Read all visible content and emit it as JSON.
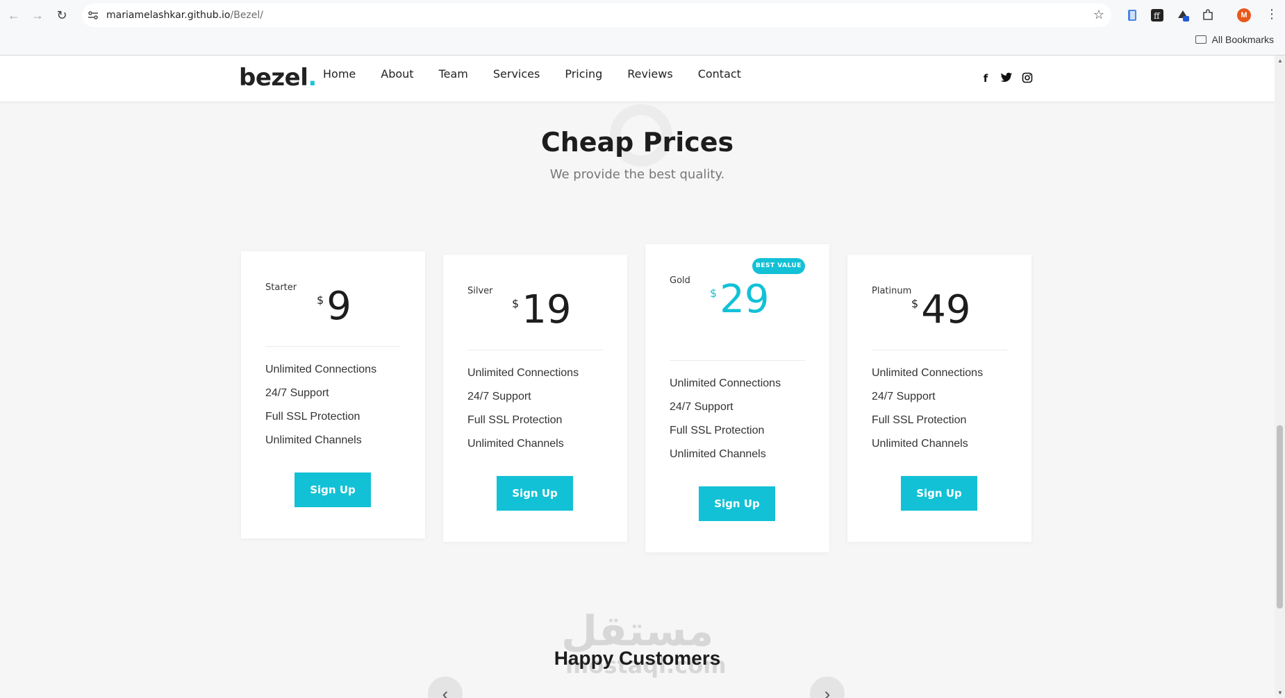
{
  "browser": {
    "url_host": "mariamelashkar.github.io",
    "url_path": "/Bezel/",
    "bookmarks_label": "All Bookmarks",
    "profile_initial": "M"
  },
  "site": {
    "logo_text": "bezel",
    "logo_dot": ".",
    "menu": [
      "Home",
      "About",
      "Team",
      "Services",
      "Pricing",
      "Reviews",
      "Contact"
    ],
    "social_icons": [
      "facebook-icon",
      "twitter-icon",
      "instagram-icon"
    ]
  },
  "pricing": {
    "title": "Cheap Prices",
    "subtitle": "We provide the best quality.",
    "currency": "$",
    "plans": [
      {
        "name": "Starter",
        "price": "9",
        "features": [
          "Unlimited Connections",
          "24/7 Support",
          "Full SSL Protection",
          "Unlimited Channels"
        ],
        "cta": "Sign Up"
      },
      {
        "name": "Silver",
        "price": "19",
        "features": [
          "Unlimited Connections",
          "24/7 Support",
          "Full SSL Protection",
          "Unlimited Channels"
        ],
        "cta": "Sign Up"
      },
      {
        "name": "Gold",
        "price": "29",
        "badge": "BEST VALUE",
        "features": [
          "Unlimited Connections",
          "24/7 Support",
          "Full SSL Protection",
          "Unlimited Channels"
        ],
        "cta": "Sign Up"
      },
      {
        "name": "Platinum",
        "price": "49",
        "features": [
          "Unlimited Connections",
          "24/7 Support",
          "Full SSL Protection",
          "Unlimited Channels"
        ],
        "cta": "Sign Up"
      }
    ]
  },
  "testimonials": {
    "title": "Happy Customers"
  },
  "watermark": {
    "arabic": "مستقل",
    "latin": "mostaql.com"
  },
  "colors": {
    "accent": "#12c1d6"
  }
}
